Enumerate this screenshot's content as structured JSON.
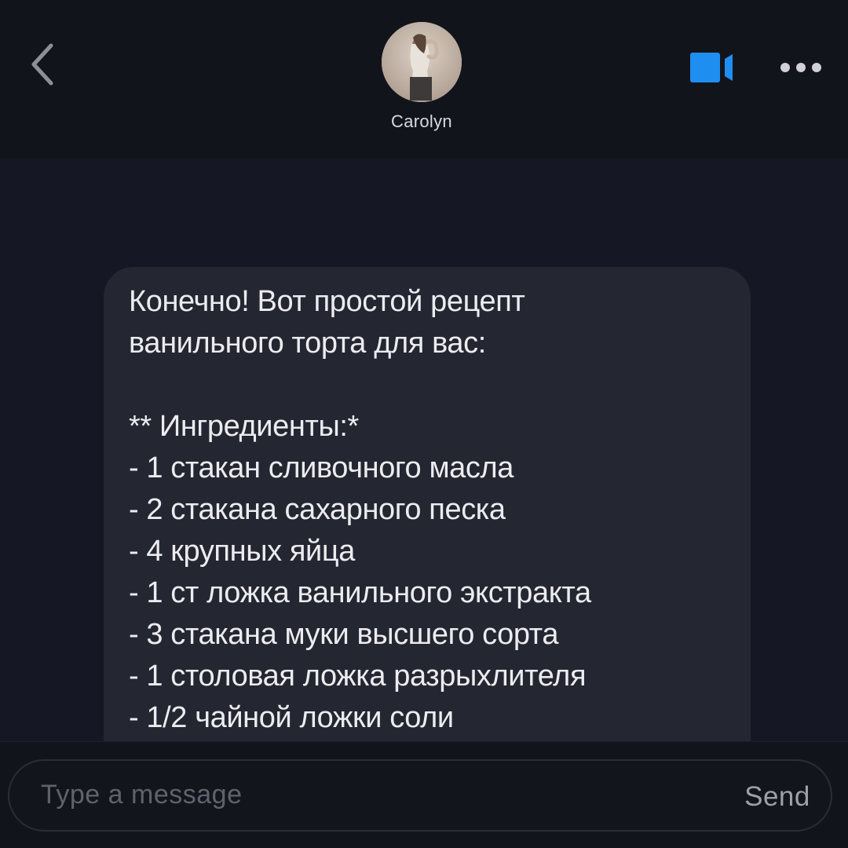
{
  "header": {
    "contact_name": "Carolyn",
    "back_icon": "chevron-left-icon",
    "video_icon": "video-camera-icon",
    "more_icon": "more-horizontal-icon",
    "accent_color": "#1f8ef1"
  },
  "message": {
    "lines": [
      "Конечно! Вот простой рецепт",
      "ванильного торта для вас:",
      "",
      "** Ингредиенты:*",
      "- 1 стакан сливочного масла",
      "- 2 стакана сахарного песка",
      "- 4 крупных яйца",
      "- 1 ст ложка ванильного экстракта",
      "- 3 стакана муки высшего сорта",
      "- 1 столовая ложка разрыхлителя",
      "- 1/2 чайной ложки соли"
    ]
  },
  "input": {
    "placeholder": "Type a message",
    "send_label": "Send"
  }
}
